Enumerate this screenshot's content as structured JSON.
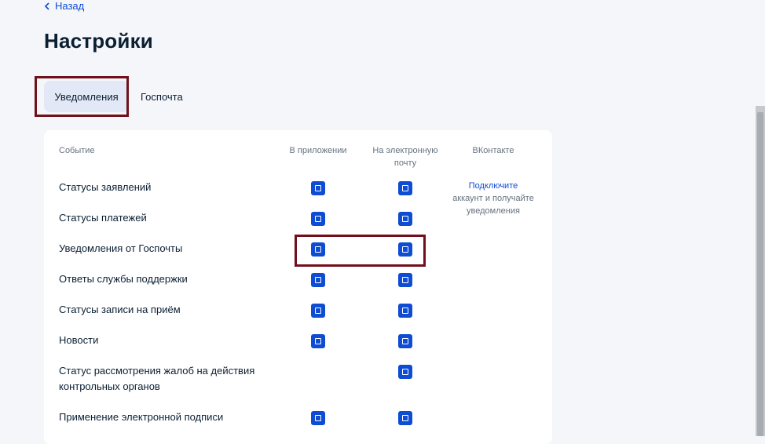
{
  "nav": {
    "back_label": "Назад",
    "back_icon": "chevron-left-icon"
  },
  "page": {
    "title": "Настройки"
  },
  "tabs": [
    {
      "label": "Уведомления",
      "active": true
    },
    {
      "label": "Госпочта",
      "active": false
    }
  ],
  "table": {
    "columns": {
      "event": "Событие",
      "app": "В приложении",
      "email_line1": "На электронную",
      "email_line2": "почту",
      "vk": "ВКонтакте"
    },
    "rows": [
      {
        "label": "Статусы заявлений",
        "app": true,
        "email": true
      },
      {
        "label": "Статусы платежей",
        "app": true,
        "email": true
      },
      {
        "label": "Уведомления от Госпочты",
        "app": true,
        "email": true
      },
      {
        "label": "Ответы службы поддержки",
        "app": true,
        "email": true
      },
      {
        "label": "Статусы записи на приём",
        "app": true,
        "email": true
      },
      {
        "label": "Новости",
        "app": true,
        "email": true
      },
      {
        "label_line1": "Статус рассмотрения жалоб на действия",
        "label_line2": "контрольных органов",
        "app": false,
        "email": true
      },
      {
        "label": "Применение электронной подписи",
        "app": true,
        "email": true
      }
    ],
    "vk_prompt": {
      "link": "Подключите",
      "line2": "аккаунт и получайте",
      "line3": "уведомления"
    }
  },
  "colors": {
    "accent": "#0d4cd3",
    "highlight": "#70101b",
    "background": "#f4f6f9"
  }
}
